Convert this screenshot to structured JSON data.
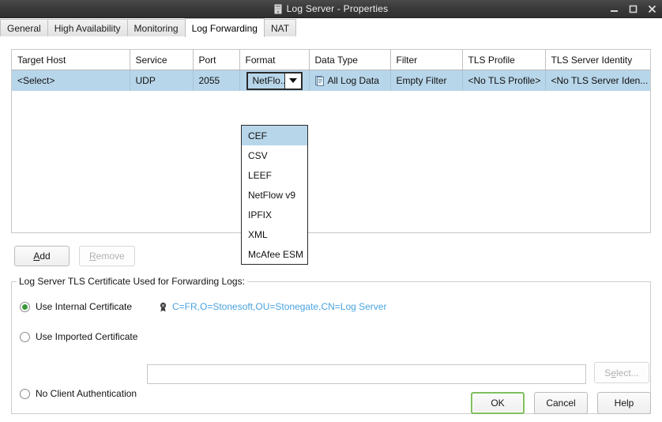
{
  "window": {
    "title": "Log Server - Properties",
    "icon": "server-icon",
    "controls": {
      "minimize": "minimize-icon",
      "maximize": "maximize-icon",
      "close": "close-icon"
    }
  },
  "tabs": [
    {
      "label": "General",
      "active": false
    },
    {
      "label": "High Availability",
      "active": false
    },
    {
      "label": "Monitoring",
      "active": false
    },
    {
      "label": "Log Forwarding",
      "active": true
    },
    {
      "label": "NAT",
      "active": false
    }
  ],
  "table": {
    "columns": [
      "Target Host",
      "Service",
      "Port",
      "Format",
      "Data Type",
      "Filter",
      "TLS Profile",
      "TLS Server Identity"
    ],
    "rows": [
      {
        "target_host": "<Select>",
        "service": "UDP",
        "port": "2055",
        "format": "NetFlo...",
        "data_type": "All Log Data",
        "data_type_icon": "log-data-icon",
        "filter": "Empty Filter",
        "tls_profile": "<No TLS Profile>",
        "tls_server_identity": "<No TLS Server Iden..."
      }
    ]
  },
  "format_dropdown": {
    "open": true,
    "options": [
      {
        "label": "CEF",
        "highlighted": true
      },
      {
        "label": "CSV",
        "highlighted": false
      },
      {
        "label": "LEEF",
        "highlighted": false
      },
      {
        "label": "NetFlow v9",
        "highlighted": false
      },
      {
        "label": "IPFIX",
        "highlighted": false
      },
      {
        "label": "XML",
        "highlighted": false
      },
      {
        "label": "McAfee ESM",
        "highlighted": false
      }
    ]
  },
  "toolbar": {
    "add_label": "Add",
    "add_mnemonic": "A",
    "remove_label": "Remove",
    "remove_mnemonic": "R"
  },
  "certificate_group": {
    "title": "Log Server TLS Certificate Used for Forwarding Logs:",
    "options": [
      {
        "label": "Use Internal Certificate",
        "selected": true
      },
      {
        "label": "Use Imported Certificate",
        "selected": false
      },
      {
        "label": "No Client Authentication",
        "selected": false
      }
    ],
    "internal_certificate_dn": "C=FR,O=Stonesoft,OU=Stonegate,CN=Log Server",
    "certificate_icon": "certificate-icon",
    "imported_certificate_value": "",
    "select_button": {
      "label": "Select...",
      "mnemonic": "e",
      "disabled": true
    }
  },
  "dialog_buttons": [
    {
      "label": "OK",
      "focused": true
    },
    {
      "label": "Cancel",
      "focused": false
    },
    {
      "label": "Help",
      "focused": false
    }
  ],
  "colors": {
    "selection": "#b8d6ea",
    "link": "#4aa3df",
    "radio_accent": "#3a9a3a",
    "focus_border": "#7fbf5f",
    "titlebar": "#3a3a3a"
  }
}
